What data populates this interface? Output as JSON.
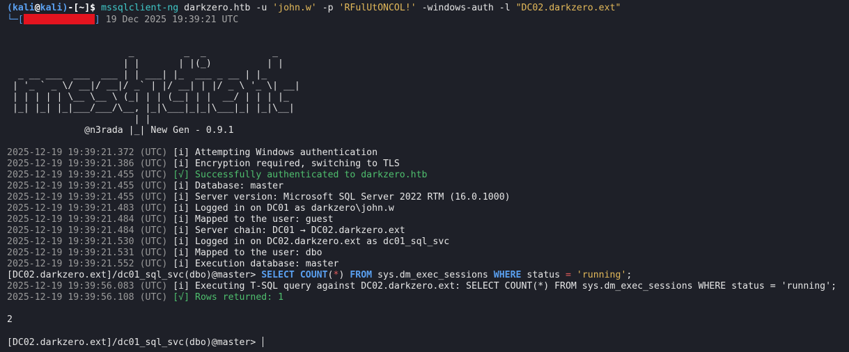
{
  "shell": {
    "paren_open": "(",
    "user": "kali",
    "at": "@",
    "host": "kali",
    "paren_close": ")",
    "dash_dir": "-[~]",
    "dollar": "$",
    "command_name": "mssqlclient-ng",
    "command_target": "darkzero.htb -u ",
    "command_user": "'john.w'",
    "command_p_flag": " -p ",
    "command_password": "'RFulUtONCOL!'",
    "command_rest": " -windows-auth -l ",
    "command_link": "\"DC02.darkzero.ext\"",
    "branch_prefix": "└─[",
    "branch_suffix": "]",
    "timestamp": " 19 Dec 2025 19:39:21 UTC"
  },
  "banner": {
    "art": [
      "                      _         _  _            _",
      "                     | |       | |(_)          | |",
      "  _ __ ___  ___  ___ | | ___| |_  ___ _ __ | |_",
      " | '_ ` _ \\/ __|/ __|/ _` | |/ __| | |/ _ \\ '_ \\| __|",
      " | | | | | \\__ \\__ \\ (_| | | (__| | |  __/ | | | |_",
      " |_| |_| |_|___/___/\\__, |_|\\___|_|_|\\___|_| |_|\\__|",
      "                       | |",
      "              @n3rada |_| New Gen - 0.9.1"
    ]
  },
  "log": [
    {
      "ts": "2025-12-19 19:39:21.372",
      "tz": "(UTC)",
      "lvl": "[i]",
      "msg": "Attempting Windows authentication",
      "ok": false
    },
    {
      "ts": "2025-12-19 19:39:21.386",
      "tz": "(UTC)",
      "lvl": "[i]",
      "msg": "Encryption required, switching to TLS",
      "ok": false
    },
    {
      "ts": "2025-12-19 19:39:21.455",
      "tz": "(UTC)",
      "lvl": "[√]",
      "msg": "Successfully authenticated to darkzero.htb",
      "ok": true
    },
    {
      "ts": "2025-12-19 19:39:21.455",
      "tz": "(UTC)",
      "lvl": "[i]",
      "msg": "Database: master",
      "ok": false
    },
    {
      "ts": "2025-12-19 19:39:21.455",
      "tz": "(UTC)",
      "lvl": "[i]",
      "msg": "Server version: Microsoft SQL Server 2022 RTM (16.0.1000)",
      "ok": false
    },
    {
      "ts": "2025-12-19 19:39:21.483",
      "tz": "(UTC)",
      "lvl": "[i]",
      "msg": "Logged in on DC01 as darkzero\\john.w",
      "ok": false
    },
    {
      "ts": "2025-12-19 19:39:21.484",
      "tz": "(UTC)",
      "lvl": "[i]",
      "msg": "Mapped to the user: guest",
      "ok": false
    },
    {
      "ts": "2025-12-19 19:39:21.484",
      "tz": "(UTC)",
      "lvl": "[i]",
      "msg": "Server chain: DC01 → DC02.darkzero.ext",
      "ok": false
    },
    {
      "ts": "2025-12-19 19:39:21.530",
      "tz": "(UTC)",
      "lvl": "[i]",
      "msg": "Logged in on DC02.darkzero.ext as dc01_sql_svc",
      "ok": false
    },
    {
      "ts": "2025-12-19 19:39:21.531",
      "tz": "(UTC)",
      "lvl": "[i]",
      "msg": "Mapped to the user: dbo",
      "ok": false
    },
    {
      "ts": "2025-12-19 19:39:21.552",
      "tz": "(UTC)",
      "lvl": "[i]",
      "msg": "Execution database: master",
      "ok": false
    }
  ],
  "query": {
    "prompt": "[DC02.darkzero.ext]/dc01_sql_svc(dbo)@master> ",
    "kw_select": "SELECT",
    "kw_count": "COUNT",
    "paren_open": "(",
    "star": "*",
    "paren_close": ")",
    "kw_from": "FROM",
    "table": " sys.dm_exec_sessions ",
    "kw_where": "WHERE",
    "col": " status ",
    "eq": "=",
    "value": "'running'",
    "semicolon": ";"
  },
  "log2": [
    {
      "ts": "2025-12-19 19:39:56.083",
      "tz": "(UTC)",
      "lvl": "[i]",
      "msg": "Executing T-SQL query against DC02.darkzero.ext: SELECT COUNT(*) FROM sys.dm_exec_sessions WHERE status = 'running';",
      "ok": false
    },
    {
      "ts": "2025-12-19 19:39:56.108",
      "tz": "(UTC)",
      "lvl": "[√]",
      "msg": "Rows returned: 1",
      "ok": true
    }
  ],
  "result": "2",
  "final_prompt": "[DC02.darkzero.ext]/dc01_sql_svc(dbo)@master> "
}
